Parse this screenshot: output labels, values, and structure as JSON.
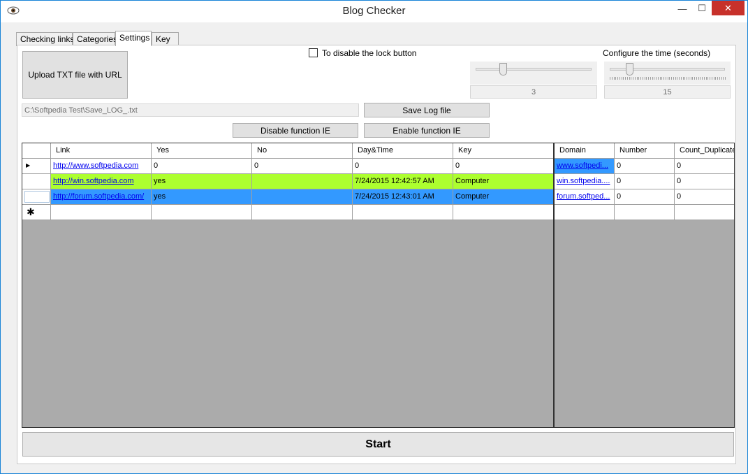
{
  "window": {
    "title": "Blog Checker",
    "min_glyph": "—",
    "max_glyph": "☐",
    "close_glyph": "✕",
    "icon": "eye-icon"
  },
  "tabs": [
    {
      "label": "Checking links"
    },
    {
      "label": "Categories"
    },
    {
      "label": "Settings",
      "active": true
    },
    {
      "label": "Key"
    }
  ],
  "settings": {
    "upload_label": "Upload TXT file with URL",
    "lock_checkbox_label": "To disable the lock button",
    "lock_checked": false,
    "configure_time_label": "Configure the time (seconds)",
    "slider1_value": "3",
    "slider2_value": "15",
    "log_path": "C:\\Softpedia Test\\Save_LOG_.txt",
    "save_log_label": "Save Log file",
    "disable_ie_label": "Disable function IE",
    "enable_ie_label": "Enable function IE",
    "start_label": "Start"
  },
  "main_grid": {
    "columns": [
      "Link",
      "Yes",
      "No",
      "Day&Time",
      "Key"
    ],
    "rows": [
      {
        "link": "http://www.softpedia.com",
        "yes": "0",
        "no": "0",
        "datetime": "0",
        "key": "0"
      },
      {
        "link": "http://win.softpedia.com",
        "yes": "yes",
        "no": "",
        "datetime": "7/24/2015 12:42:57 AM",
        "key": "Computer"
      },
      {
        "link": "http://forum.softpedia.com/",
        "yes": "yes",
        "no": "",
        "datetime": "7/24/2015 12:43:01 AM",
        "key": "Computer"
      }
    ],
    "current_row_glyph": "▶",
    "new_row_glyph": "✱"
  },
  "side_grid": {
    "columns": [
      "Domain",
      "Number",
      "Count_Duplicate"
    ],
    "rows": [
      {
        "domain": "www.softpedi...",
        "number": "0",
        "count": "0"
      },
      {
        "domain": "win.softpedia....",
        "number": "0",
        "count": "0"
      },
      {
        "domain": "forum.softped...",
        "number": "0",
        "count": "0"
      }
    ]
  },
  "colors": {
    "accent_blue": "#3399ff",
    "highlight_green": "#adff2f",
    "grid_background": "#ababab",
    "close_red": "#c7312b"
  }
}
